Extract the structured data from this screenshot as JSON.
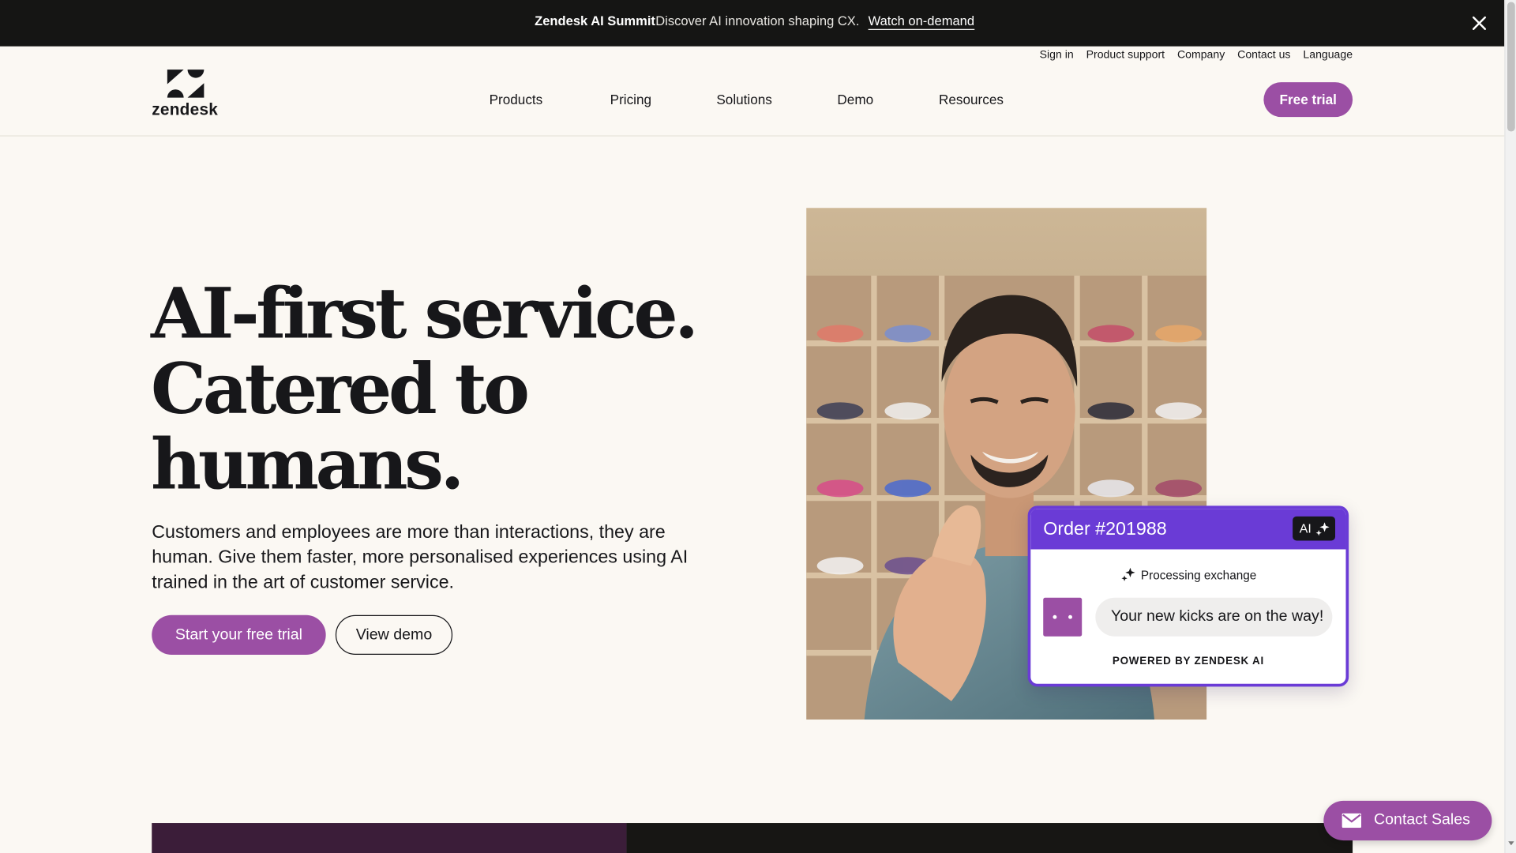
{
  "announcement": {
    "title": "Zendesk AI Summit",
    "description": "Discover AI innovation shaping CX.",
    "link_label": "Watch on-demand"
  },
  "header": {
    "logo_text": "zendesk",
    "utility_links": [
      "Sign in",
      "Product support",
      "Company",
      "Contact us",
      "Language"
    ],
    "nav": [
      "Products",
      "Pricing",
      "Solutions",
      "Demo",
      "Resources"
    ],
    "cta_label": "Free trial"
  },
  "hero": {
    "title_lines": [
      "AI-first service.",
      "Catered to",
      "humans."
    ],
    "subtitle": "Customers and employees are more than interactions, they are human. Give them faster, more personalised experiences using AI trained in the art of customer service.",
    "primary_cta": "Start your free trial",
    "secondary_cta": "View demo"
  },
  "order_card": {
    "title": "Order #201988",
    "badge": "AI",
    "status": "Processing exchange",
    "message": "Your new kicks are on the way!",
    "footer": "POWERED BY ZENDESK AI"
  },
  "contact_sales": {
    "label": "Contact Sales"
  },
  "colors": {
    "brand_purple": "#9b4fa4",
    "card_accent": "#6a3bd6",
    "dark_bar": "#151514",
    "page_bg": "#fbf8f3"
  }
}
